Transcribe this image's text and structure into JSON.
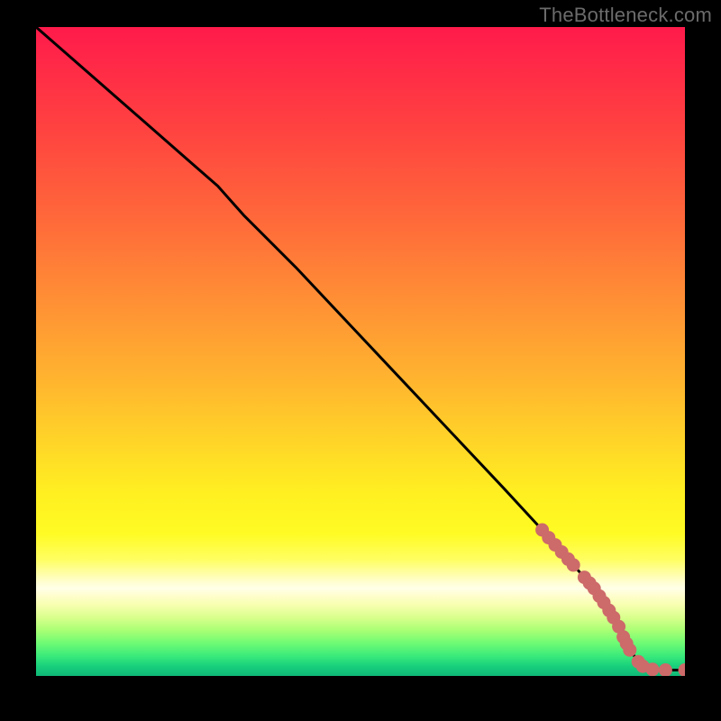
{
  "watermark": "TheBottleneck.com",
  "colors": {
    "dot": "#cd6a6a",
    "line": "#000000",
    "frame": "#000000"
  },
  "chart_data": {
    "type": "line",
    "title": "",
    "xlabel": "",
    "ylabel": "",
    "xlim": [
      0,
      100
    ],
    "ylim": [
      0,
      100
    ],
    "series": [
      {
        "name": "curve",
        "x": [
          0,
          8,
          16,
          24,
          28,
          32,
          40,
          48,
          56,
          64,
          72,
          78,
          82,
          86,
          88,
          90,
          91.5,
          93,
          95,
          97,
          100
        ],
        "y": [
          100,
          93,
          86,
          79,
          75.5,
          71,
          63,
          54.5,
          46,
          37.5,
          29,
          22.5,
          18,
          13.5,
          10.5,
          7,
          4,
          2,
          1,
          0.9,
          0.9
        ]
      }
    ],
    "scatter": [
      {
        "name": "markers",
        "note": "approximate salmon point cluster along lower-right tail",
        "points": [
          {
            "x": 78,
            "y": 22.5
          },
          {
            "x": 79,
            "y": 21.3
          },
          {
            "x": 80,
            "y": 20.2
          },
          {
            "x": 81,
            "y": 19.1
          },
          {
            "x": 82,
            "y": 18.0
          },
          {
            "x": 82.8,
            "y": 17.1
          },
          {
            "x": 84.5,
            "y": 15.2
          },
          {
            "x": 85.3,
            "y": 14.3
          },
          {
            "x": 86,
            "y": 13.5
          },
          {
            "x": 86.8,
            "y": 12.3
          },
          {
            "x": 87.5,
            "y": 11.3
          },
          {
            "x": 88.3,
            "y": 10.1
          },
          {
            "x": 89,
            "y": 9.0
          },
          {
            "x": 89.8,
            "y": 7.6
          },
          {
            "x": 90.5,
            "y": 6.0
          },
          {
            "x": 91,
            "y": 5.0
          },
          {
            "x": 91.5,
            "y": 4.0
          },
          {
            "x": 92.8,
            "y": 2.2
          },
          {
            "x": 93.5,
            "y": 1.5
          },
          {
            "x": 95,
            "y": 1.0
          },
          {
            "x": 97,
            "y": 0.9
          },
          {
            "x": 100,
            "y": 0.9
          }
        ]
      }
    ]
  }
}
